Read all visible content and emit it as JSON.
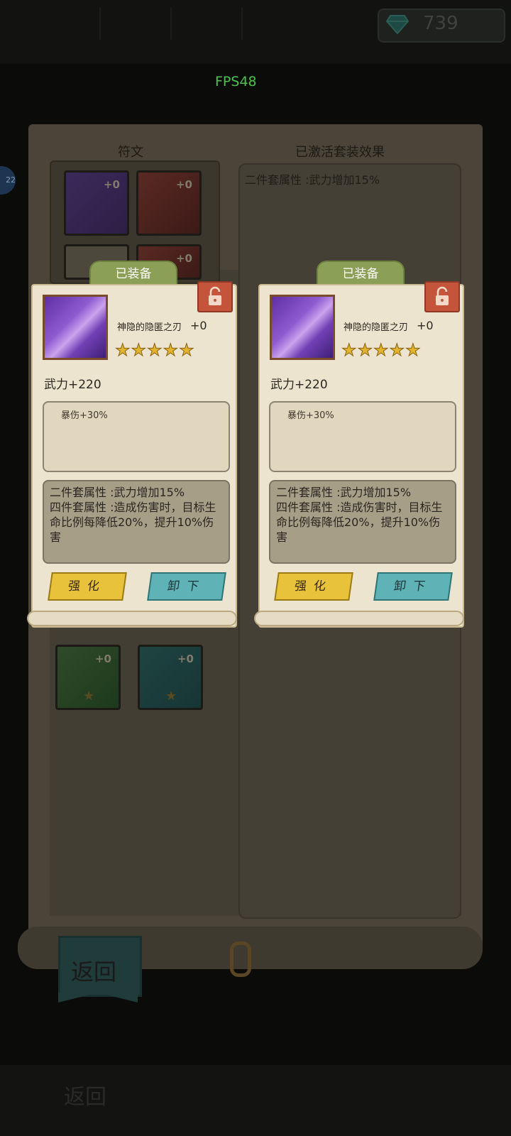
{
  "top_tabs": [
    "",
    "",
    "",
    ""
  ],
  "currency": {
    "gem_value": "739",
    "icon": "gem-icon"
  },
  "fps": "FPS48",
  "side_badge": "22",
  "panel": {
    "left_title": "符文",
    "right_title": "已激活套装效果",
    "active_set_text": "二件套属性 :武力增加15%"
  },
  "back_slots": [
    {
      "value": "+0",
      "color": "purple"
    },
    {
      "value": "+0",
      "color": "red"
    },
    {
      "value": "",
      "color": "grey"
    },
    {
      "value": "+0",
      "color": "red"
    }
  ],
  "lower_slots": [
    {
      "value": "+0",
      "star": "★",
      "color": "green"
    },
    {
      "value": "+0",
      "star": "★",
      "color": "teal"
    }
  ],
  "cards": [
    {
      "tab_label": "已装备",
      "name": "神隐的隐匿之刃",
      "enhance": "+0",
      "stars": "★★★★★",
      "main_stat": "武力+220",
      "sub_stat": "暴伤+30%",
      "set_effects": "二件套属性 :武力增加15%\n四件套属性 :造成伤害时，目标生命比例每降低20%，提升10%伤害",
      "enhance_button": "强化",
      "unequip_button": "卸下"
    },
    {
      "tab_label": "已装备",
      "name": "神隐的隐匿之刃",
      "enhance": "+0",
      "stars": "★★★★★",
      "main_stat": "武力+220",
      "sub_stat": "暴伤+30%",
      "set_effects": "二件套属性 :武力增加15%\n四件套属性 :造成伤害时，目标生命比例每降低20%，提升10%伤害",
      "enhance_button": "强化",
      "unequip_button": "卸下"
    }
  ],
  "back_button": "返回",
  "bottom_back": "返回",
  "colors": {
    "fps_green": "#47c44a",
    "tab_green": "#8c9f56",
    "lock_red": "#c4553a",
    "btn_yellow": "#e7c23a",
    "btn_teal": "#5fb2b5"
  }
}
